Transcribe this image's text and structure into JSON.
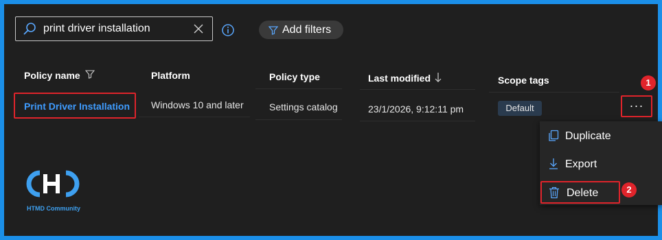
{
  "search": {
    "value": "print driver installation"
  },
  "toolbar": {
    "add_filters_label": "Add filters"
  },
  "table": {
    "headers": {
      "policy_name": "Policy name",
      "platform": "Platform",
      "policy_type": "Policy type",
      "last_modified": "Last modified",
      "scope_tags": "Scope tags"
    },
    "rows": [
      {
        "policy_name": "Print Driver Installation",
        "platform": "Windows 10 and later",
        "policy_type": "Settings catalog",
        "last_modified": "23/1/2026, 9:12:11 pm",
        "scope_tag": "Default"
      }
    ]
  },
  "row_actions": {
    "more_label": "···"
  },
  "context_menu": {
    "items": [
      {
        "label": "Duplicate",
        "icon": "duplicate-icon"
      },
      {
        "label": "Export",
        "icon": "download-icon"
      },
      {
        "label": "Delete",
        "icon": "trash-icon"
      }
    ]
  },
  "annotations": {
    "marker_1": "1",
    "marker_2": "2"
  },
  "watermark": {
    "text": "HTMD Community"
  },
  "colors": {
    "accent": "#3f9cff",
    "highlight": "#e0242b",
    "background": "#1f1f1f",
    "border_frame": "#1b8fe8"
  }
}
